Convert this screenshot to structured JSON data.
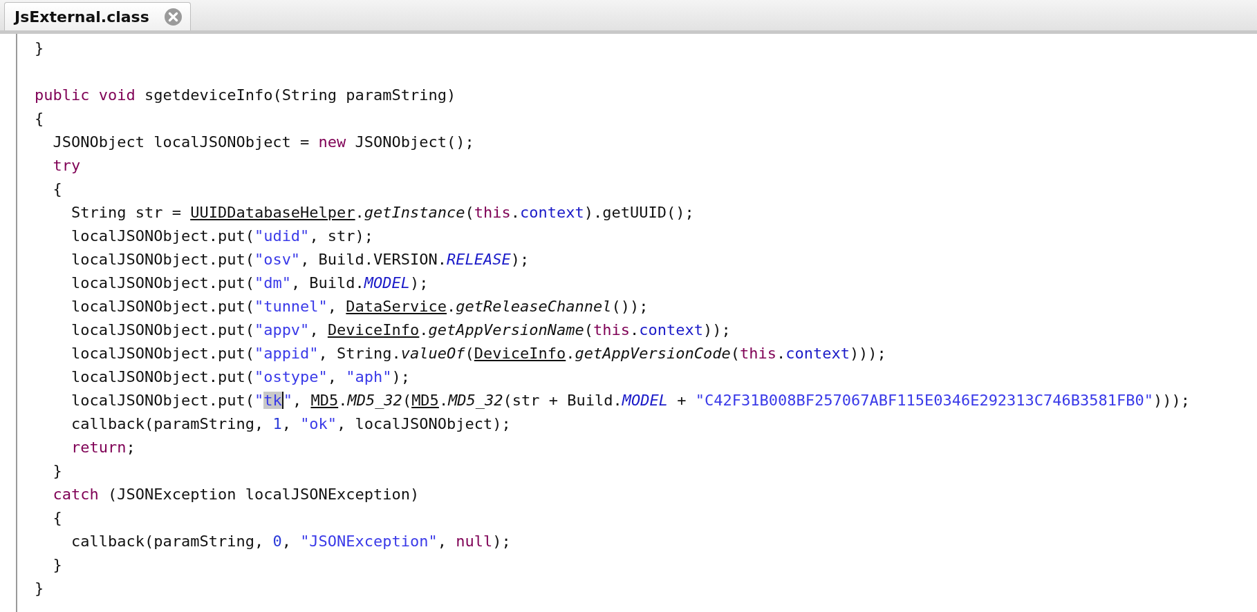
{
  "tabs": [
    {
      "label": "JsExternal.class",
      "selected": true
    }
  ],
  "code_lines": [
    {
      "kind": "code",
      "tokens": [
        {
          "text": "}",
          "kind": "plain"
        }
      ]
    },
    {
      "kind": "blank"
    },
    {
      "kind": "code",
      "tokens": [
        {
          "text": "public void",
          "kind": "keyword"
        },
        {
          "text": " sgetdeviceInfo(String paramString)",
          "kind": "plain"
        }
      ]
    },
    {
      "kind": "code",
      "tokens": [
        {
          "text": "{",
          "kind": "plain"
        }
      ]
    },
    {
      "kind": "code",
      "tokens": [
        {
          "text": "  JSONObject localJSONObject = ",
          "kind": "plain"
        },
        {
          "text": "new",
          "kind": "keyword"
        },
        {
          "text": " JSONObject();",
          "kind": "plain"
        }
      ]
    },
    {
      "kind": "code",
      "tokens": [
        {
          "text": "  try",
          "kind": "keyword"
        }
      ]
    },
    {
      "kind": "code",
      "tokens": [
        {
          "text": "  {",
          "kind": "plain"
        }
      ]
    },
    {
      "kind": "code",
      "tokens": [
        {
          "text": "    String str = ",
          "kind": "plain"
        },
        {
          "text": "UUIDDatabaseHelper",
          "kind": "link"
        },
        {
          "text": ".",
          "kind": "plain"
        },
        {
          "text": "getInstance",
          "kind": "static_method"
        },
        {
          "text": "(",
          "kind": "plain"
        },
        {
          "text": "this",
          "kind": "keyword"
        },
        {
          "text": ".",
          "kind": "plain"
        },
        {
          "text": "context",
          "kind": "field"
        },
        {
          "text": ").getUUID();",
          "kind": "plain"
        }
      ]
    },
    {
      "kind": "code",
      "tokens": [
        {
          "text": "    localJSONObject.put(",
          "kind": "plain"
        },
        {
          "text": "\"udid\"",
          "kind": "string"
        },
        {
          "text": ", str);",
          "kind": "plain"
        }
      ]
    },
    {
      "kind": "code",
      "tokens": [
        {
          "text": "    localJSONObject.put(",
          "kind": "plain"
        },
        {
          "text": "\"osv\"",
          "kind": "string"
        },
        {
          "text": ", Build.VERSION.",
          "kind": "plain"
        },
        {
          "text": "RELEASE",
          "kind": "static_field"
        },
        {
          "text": ");",
          "kind": "plain"
        }
      ]
    },
    {
      "kind": "code",
      "tokens": [
        {
          "text": "    localJSONObject.put(",
          "kind": "plain"
        },
        {
          "text": "\"dm\"",
          "kind": "string"
        },
        {
          "text": ", Build.",
          "kind": "plain"
        },
        {
          "text": "MODEL",
          "kind": "static_field"
        },
        {
          "text": ");",
          "kind": "plain"
        }
      ]
    },
    {
      "kind": "code",
      "tokens": [
        {
          "text": "    localJSONObject.put(",
          "kind": "plain"
        },
        {
          "text": "\"tunnel\"",
          "kind": "string"
        },
        {
          "text": ", ",
          "kind": "plain"
        },
        {
          "text": "DataService",
          "kind": "link"
        },
        {
          "text": ".",
          "kind": "plain"
        },
        {
          "text": "getReleaseChannel",
          "kind": "static_method"
        },
        {
          "text": "());",
          "kind": "plain"
        }
      ]
    },
    {
      "kind": "code",
      "tokens": [
        {
          "text": "    localJSONObject.put(",
          "kind": "plain"
        },
        {
          "text": "\"appv\"",
          "kind": "string"
        },
        {
          "text": ", ",
          "kind": "plain"
        },
        {
          "text": "DeviceInfo",
          "kind": "link"
        },
        {
          "text": ".",
          "kind": "plain"
        },
        {
          "text": "getAppVersionName",
          "kind": "static_method"
        },
        {
          "text": "(",
          "kind": "plain"
        },
        {
          "text": "this",
          "kind": "keyword"
        },
        {
          "text": ".",
          "kind": "plain"
        },
        {
          "text": "context",
          "kind": "field"
        },
        {
          "text": "));",
          "kind": "plain"
        }
      ]
    },
    {
      "kind": "code",
      "tokens": [
        {
          "text": "    localJSONObject.put(",
          "kind": "plain"
        },
        {
          "text": "\"appid\"",
          "kind": "string"
        },
        {
          "text": ", String.",
          "kind": "plain"
        },
        {
          "text": "valueOf",
          "kind": "static_method"
        },
        {
          "text": "(",
          "kind": "plain"
        },
        {
          "text": "DeviceInfo",
          "kind": "link"
        },
        {
          "text": ".",
          "kind": "plain"
        },
        {
          "text": "getAppVersionCode",
          "kind": "static_method"
        },
        {
          "text": "(",
          "kind": "plain"
        },
        {
          "text": "this",
          "kind": "keyword"
        },
        {
          "text": ".",
          "kind": "plain"
        },
        {
          "text": "context",
          "kind": "field"
        },
        {
          "text": ")));",
          "kind": "plain"
        }
      ]
    },
    {
      "kind": "code",
      "tokens": [
        {
          "text": "    localJSONObject.put(",
          "kind": "plain"
        },
        {
          "text": "\"ostype\"",
          "kind": "string"
        },
        {
          "text": ", ",
          "kind": "plain"
        },
        {
          "text": "\"aph\"",
          "kind": "string"
        },
        {
          "text": ");",
          "kind": "plain"
        }
      ]
    },
    {
      "kind": "code",
      "tokens": [
        {
          "text": "    localJSONObject.put(",
          "kind": "plain"
        },
        {
          "text": "\"",
          "kind": "string"
        },
        {
          "text": "tk",
          "kind": "string",
          "highlighted": true
        },
        {
          "text": "\"",
          "kind": "string"
        },
        {
          "text": ", ",
          "kind": "plain"
        },
        {
          "text": "MD5",
          "kind": "link"
        },
        {
          "text": ".",
          "kind": "plain"
        },
        {
          "text": "MD5_32",
          "kind": "static_method"
        },
        {
          "text": "(",
          "kind": "plain"
        },
        {
          "text": "MD5",
          "kind": "link"
        },
        {
          "text": ".",
          "kind": "plain"
        },
        {
          "text": "MD5_32",
          "kind": "static_method"
        },
        {
          "text": "(str + Build.",
          "kind": "plain"
        },
        {
          "text": "MODEL",
          "kind": "static_field"
        },
        {
          "text": " + ",
          "kind": "plain"
        },
        {
          "text": "\"C42F31B008BF257067ABF115E0346E292313C746B3581FB0\"",
          "kind": "string"
        },
        {
          "text": ")));",
          "kind": "plain"
        }
      ]
    },
    {
      "kind": "code",
      "tokens": [
        {
          "text": "    callback(paramString, ",
          "kind": "plain"
        },
        {
          "text": "1",
          "kind": "number"
        },
        {
          "text": ", ",
          "kind": "plain"
        },
        {
          "text": "\"ok\"",
          "kind": "string"
        },
        {
          "text": ", localJSONObject);",
          "kind": "plain"
        }
      ]
    },
    {
      "kind": "code",
      "tokens": [
        {
          "text": "    return",
          "kind": "keyword"
        },
        {
          "text": ";",
          "kind": "plain"
        }
      ]
    },
    {
      "kind": "code",
      "tokens": [
        {
          "text": "  }",
          "kind": "plain"
        }
      ]
    },
    {
      "kind": "code",
      "tokens": [
        {
          "text": "  catch",
          "kind": "keyword"
        },
        {
          "text": " (JSONException localJSONException)",
          "kind": "plain"
        }
      ]
    },
    {
      "kind": "code",
      "tokens": [
        {
          "text": "  {",
          "kind": "plain"
        }
      ]
    },
    {
      "kind": "code",
      "tokens": [
        {
          "text": "    callback(paramString, ",
          "kind": "plain"
        },
        {
          "text": "0",
          "kind": "number"
        },
        {
          "text": ", ",
          "kind": "plain"
        },
        {
          "text": "\"JSONException\"",
          "kind": "string"
        },
        {
          "text": ", ",
          "kind": "plain"
        },
        {
          "text": "null",
          "kind": "keyword"
        },
        {
          "text": ");",
          "kind": "plain"
        }
      ]
    },
    {
      "kind": "code",
      "tokens": [
        {
          "text": "  }",
          "kind": "plain"
        }
      ]
    },
    {
      "kind": "code",
      "tokens": [
        {
          "text": "}",
          "kind": "plain"
        }
      ]
    }
  ]
}
